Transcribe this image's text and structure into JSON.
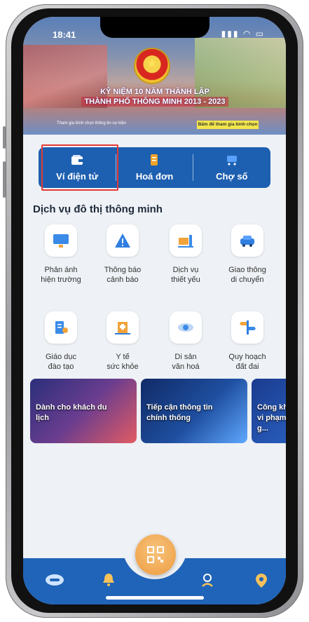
{
  "status_bar": {
    "time": "18:41"
  },
  "banner": {
    "line1": "KỶ NIỆM 10 NĂM THÀNH LẬP",
    "line2": "THÀNH PHỐ THÔNG MINH 2013 - 2023",
    "small_text": "Tham gia bình chọn thông tin sự kiện",
    "cta": "Bấm để tham gia bình chọn"
  },
  "actions": [
    {
      "label": "Ví điện tử",
      "icon": "wallet-icon"
    },
    {
      "label": "Hoá đơn",
      "icon": "invoice-icon"
    },
    {
      "label": "Chợ số",
      "icon": "cart-icon"
    }
  ],
  "section": {
    "title": "Dịch vụ đô thị thông minh"
  },
  "services": [
    {
      "label_1": "Phản ánh",
      "label_2": "hiện trường",
      "icon": "monitor-icon"
    },
    {
      "label_1": "Thông báo",
      "label_2": "cảnh báo",
      "icon": "warning-icon"
    },
    {
      "label_1": "Dịch vụ",
      "label_2": "thiết yếu",
      "icon": "utility-icon"
    },
    {
      "label_1": "Giao thông",
      "label_2": "di chuyển",
      "icon": "car-icon"
    },
    {
      "label_1": "Giáo dục",
      "label_2": "đào tạo",
      "icon": "education-icon"
    },
    {
      "label_1": "Y tế",
      "label_2": "sức khỏe",
      "icon": "hospital-icon"
    },
    {
      "label_1": "Di sản",
      "label_2": "văn hoá",
      "icon": "heritage-icon"
    },
    {
      "label_1": "Quy hoạch",
      "label_2": "đất đai",
      "icon": "signpost-icon"
    }
  ],
  "cards": [
    {
      "label": "Dành cho khách du lịch"
    },
    {
      "label": "Tiếp cận thông tin chính thống"
    },
    {
      "label": "Công khai vi phạm g..."
    }
  ],
  "colors": {
    "primary": "#1d5fb0",
    "accent": "#ee9b3e",
    "highlight": "#e53935"
  }
}
